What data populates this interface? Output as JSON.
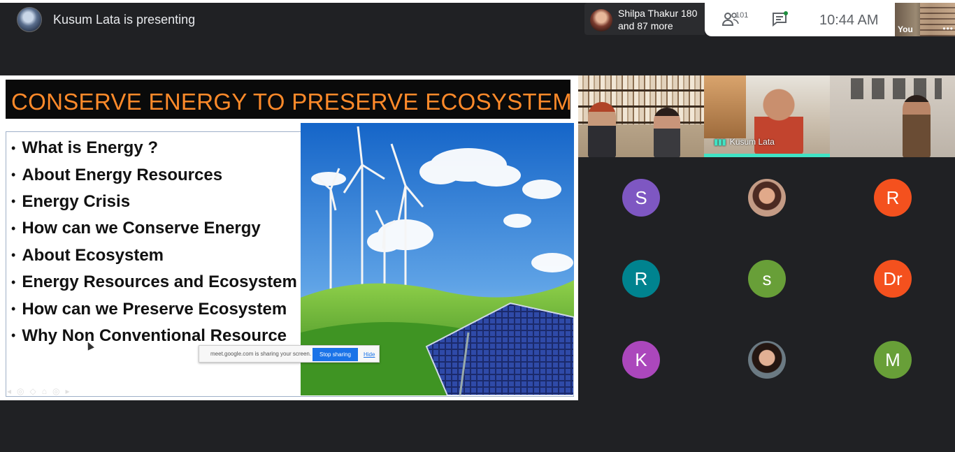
{
  "presenter": {
    "text": "Kusum Lata is presenting"
  },
  "notification": {
    "line1": "Shilpa Thakur 180",
    "line2": "and 87 more"
  },
  "controls": {
    "participant_count": "101",
    "time": "10:44 AM",
    "self_label": "You",
    "more_options": "•••"
  },
  "slide": {
    "title": "CONSERVE ENERGY TO PRESERVE ECOSYSTEM",
    "bullets": [
      "What is Energy ?",
      "About Energy Resources",
      "Energy Crisis",
      "How can we Conserve Energy",
      "About Ecosystem",
      "Energy Resources and Ecosystem",
      "How can we Preserve Ecosystem",
      "Why Non Conventional Resource"
    ],
    "bullet_glyph": "•"
  },
  "share_bar": {
    "message": "meet.google.com is sharing your screen.",
    "stop_label": "Stop sharing",
    "hide_label": "Hide"
  },
  "tiles": {
    "active_speaker": "Kusum Lata"
  },
  "avatars": [
    {
      "initial": "S",
      "color": "#7e57c2"
    },
    {
      "initial": "",
      "color": ""
    },
    {
      "initial": "R",
      "color": "#f4511e"
    },
    {
      "initial": "R",
      "color": "#00838f"
    },
    {
      "initial": "s",
      "color": "#689f38"
    },
    {
      "initial": "Dr",
      "color": "#f4511e"
    },
    {
      "initial": "K",
      "color": "#ab47bc"
    },
    {
      "initial": "",
      "color": ""
    },
    {
      "initial": "M",
      "color": "#689f38"
    }
  ],
  "colors": {
    "accent": "#41e3c4",
    "slide_title": "#ff8a2a",
    "stop_button": "#1a73e8"
  }
}
